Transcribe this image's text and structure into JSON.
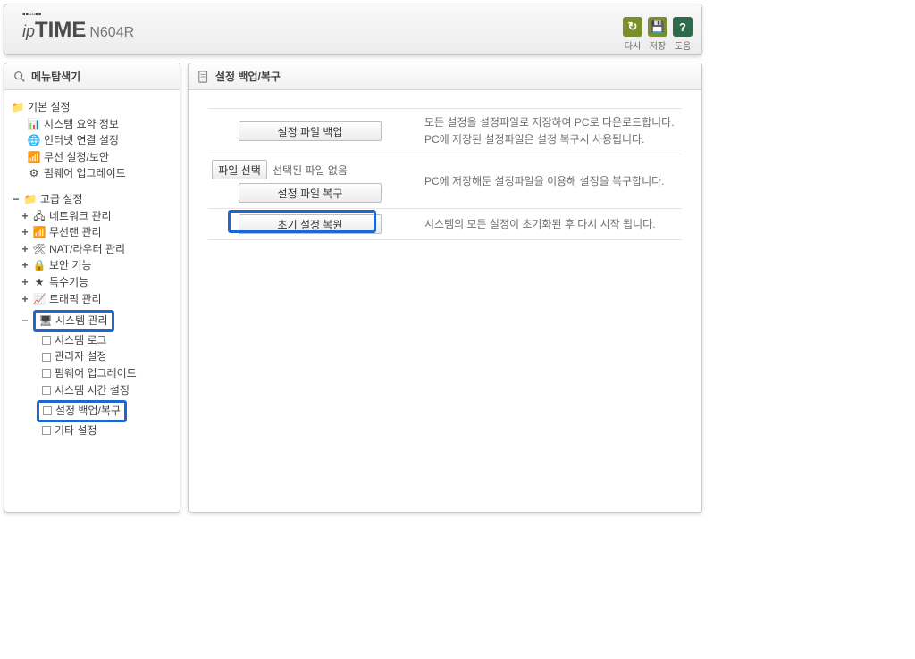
{
  "brand": {
    "ip": "ip",
    "time": "TIME",
    "model": "N604R"
  },
  "header_tools": {
    "refresh": "다시",
    "save": "저장",
    "help": "도움"
  },
  "sidebar": {
    "title": "메뉴탐색기",
    "basic": {
      "label": "기본 설정",
      "items": {
        "summary": "시스템 요약 정보",
        "internet": "인터넷 연결 설정",
        "wireless": "무선 설정/보안",
        "firmware": "펌웨어 업그레이드"
      }
    },
    "advanced": {
      "label": "고급 설정",
      "groups": {
        "network": "네트워크 관리",
        "wlan": "무선랜 관리",
        "nat": "NAT/라우터 관리",
        "sec": "보안 기능",
        "special": "특수기능",
        "traffic": "트래픽 관리",
        "system": "시스템 관리"
      },
      "system_children": {
        "log": "시스템 로그",
        "admin": "관리자 설정",
        "fw": "펌웨어 업그레이드",
        "time": "시스템 시간 설정",
        "backup": "설정 백업/복구",
        "etc": "기타 설정"
      }
    }
  },
  "main": {
    "title": "설정 백업/복구",
    "rows": {
      "backup_btn": "설정 파일 백업",
      "backup_desc1": "모든 설정을 설정파일로 저장하여 PC로 다운로드합니다.",
      "backup_desc2": "PC에 저장된 설정파일은 설정 복구시 사용됩니다.",
      "file_btn": "파일 선택",
      "file_state": "선택된 파일 없음",
      "restore_btn": "설정 파일 복구",
      "restore_desc": "PC에 저장해둔 설정파일을 이용해 설정을 복구합니다.",
      "reset_btn": "초기 설정 복원",
      "reset_desc": "시스템의 모든 설정이 초기화된 후 다시 시작 됩니다."
    }
  }
}
